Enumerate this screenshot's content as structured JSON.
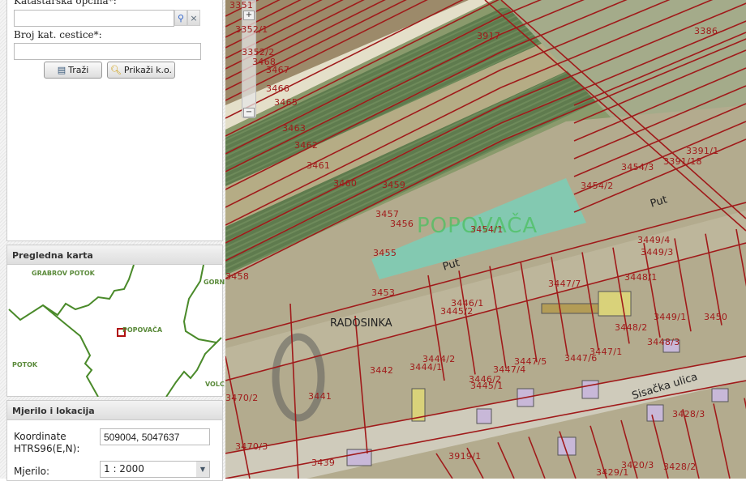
{
  "search": {
    "cadastral_label": "Katastarska općina*:",
    "cadastral_value": "",
    "parcel_label": "Broj kat. cestice*:",
    "parcel_value": "",
    "search_button": "Traži",
    "show_button": "Prikaži k.o.",
    "clear_icon": "×"
  },
  "overview": {
    "title": "Pregledna karta",
    "places": [
      "GRABROV POTOK",
      "GORN",
      "POPOVAČA",
      "POTOK",
      "VOLC"
    ]
  },
  "scale": {
    "title": "Mjerilo i lokacija",
    "coord_label": "Koordinate HTRS96(E,N):",
    "coord_value": "509004, 5047637",
    "scale_label": "Mjerilo:",
    "scale_value": "1 : 2000"
  },
  "map": {
    "zoom_in": "+",
    "zoom_out": "−",
    "town_label": "POPOVAČA",
    "area_label": "RADOSINKA",
    "street_label": "Sisačka ulica",
    "road_labels": [
      "Put",
      "Put"
    ],
    "parcels": [
      "3351",
      "3352/1",
      "3352/2",
      "3468",
      "3467",
      "3466",
      "3465",
      "3463",
      "3462",
      "3461",
      "3460",
      "3459",
      "3457",
      "3456",
      "3455",
      "3454/1",
      "3454/2",
      "3454/3",
      "3453",
      "3458",
      "3917",
      "3386",
      "3391/1",
      "3391/18",
      "3449/4",
      "3449/3",
      "3448/1",
      "3447/7",
      "3446/1",
      "3445/2",
      "3444/2",
      "3444/1",
      "3442",
      "3441",
      "3470/2",
      "3470/3",
      "3439",
      "3919/1",
      "3447/5",
      "3447/6",
      "3447/1",
      "3447/4",
      "3446/2",
      "3445/1",
      "3449/1",
      "3448/2",
      "3448/3",
      "3450",
      "3428/3",
      "3428/2",
      "3429/1",
      "3420/3"
    ]
  },
  "colors": {
    "parcel_line": "#a01a1a",
    "overview_line": "#4a8a2a",
    "highlight": "#6fd6c0"
  }
}
